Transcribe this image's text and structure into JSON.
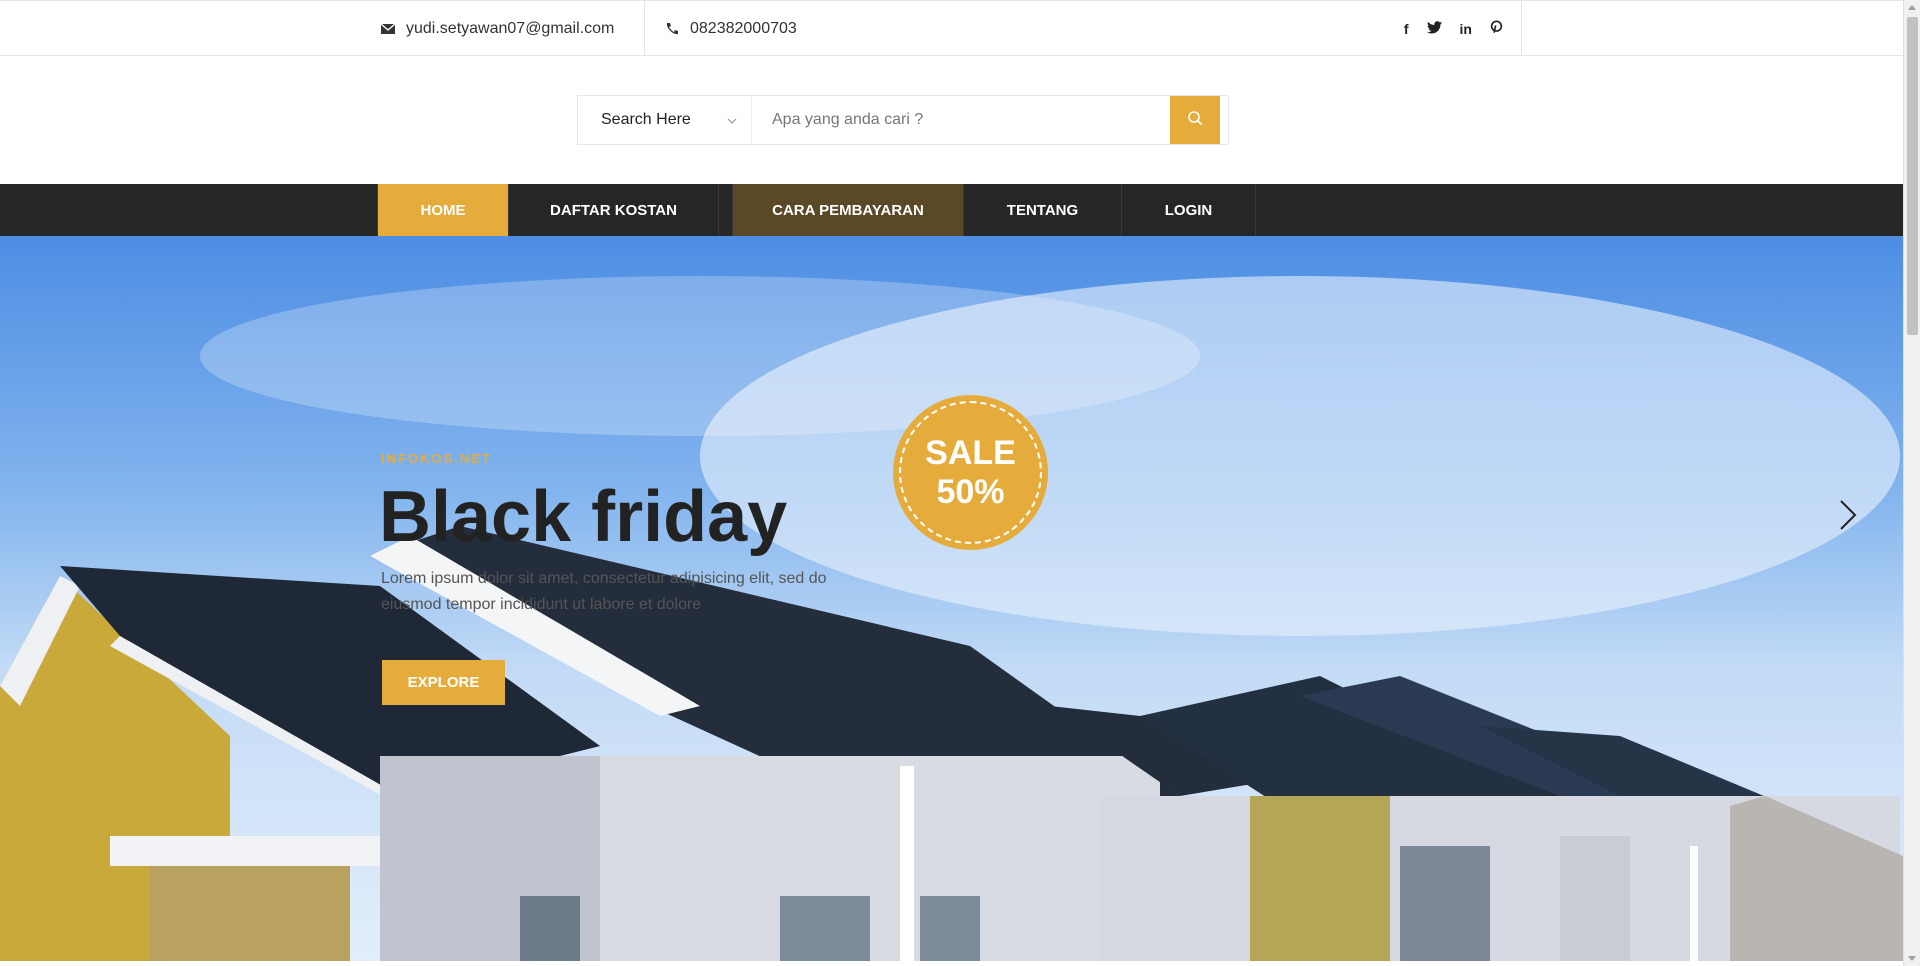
{
  "topbar": {
    "email": "yudi.setyawan07@gmail.com",
    "phone": "082382000703",
    "social": {
      "facebook": "f",
      "twitter": "t",
      "linkedin": "in",
      "pinterest": "p"
    }
  },
  "search": {
    "category_label": "Search Here",
    "placeholder": "Apa yang anda cari ?"
  },
  "nav": {
    "items": [
      {
        "label": "HOME"
      },
      {
        "label": "DAFTAR KOSTAN"
      },
      {
        "label": "CARA PEMBAYARAN"
      },
      {
        "label": "TENTANG"
      },
      {
        "label": "LOGIN"
      }
    ]
  },
  "hero": {
    "kicker": "INFOKOS.NET",
    "headline": "Black friday",
    "description": "Lorem ipsum dolor sit amet, consectetur adipisicing elit, sed do eiusmod tempor incididunt ut labore et dolore",
    "button_label": "EXPLORE",
    "badge_line1": "SALE",
    "badge_line2": "50%"
  },
  "colors": {
    "accent": "#e5ac3c",
    "nav_bg": "#262626",
    "nav_active_dim": "#5a4826"
  }
}
